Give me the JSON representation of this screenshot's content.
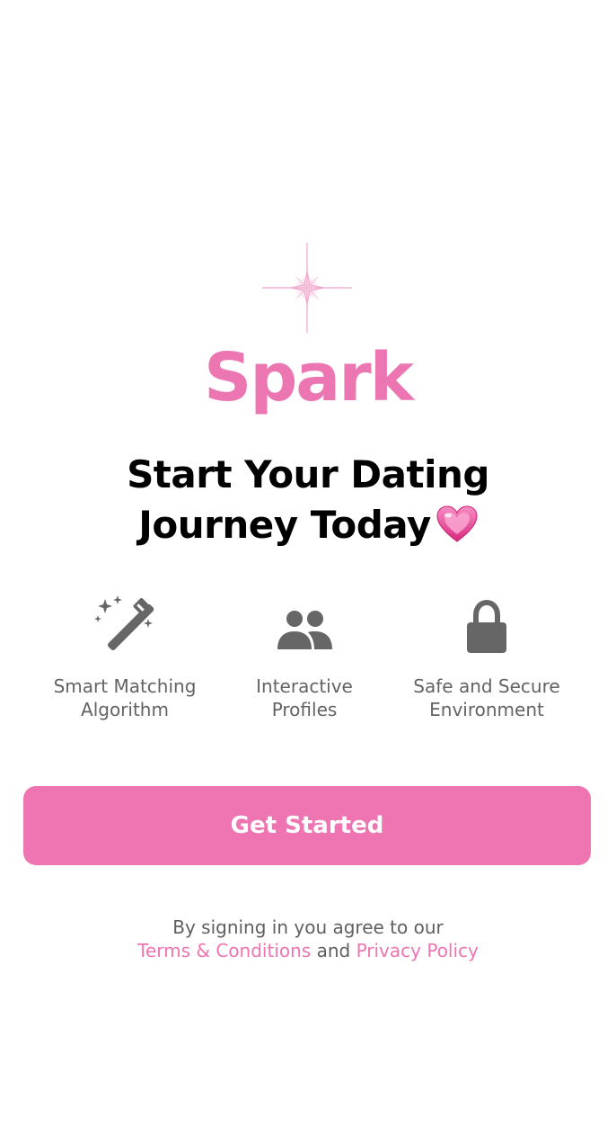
{
  "app": {
    "name": "Spark"
  },
  "headline": {
    "line1": "Start Your Dating",
    "line2": "Journey Today"
  },
  "features": [
    {
      "icon": "magic-wand-icon",
      "line1": "Smart Matching",
      "line2": "Algorithm"
    },
    {
      "icon": "people-icon",
      "line1": "Interactive",
      "line2": "Profiles"
    },
    {
      "icon": "lock-icon",
      "line1": "Safe and Secure",
      "line2": "Environment"
    }
  ],
  "cta": {
    "label": "Get Started"
  },
  "legal": {
    "prefix": "By signing in you agree to our",
    "terms_label": "Terms & Conditions",
    "conjunction": "and",
    "privacy_label": "Privacy Policy"
  },
  "colors": {
    "accent": "#ee75b1",
    "icon_gray": "#666666",
    "text_gray": "#636363",
    "heading": "#000000",
    "background": "#ffffff"
  }
}
